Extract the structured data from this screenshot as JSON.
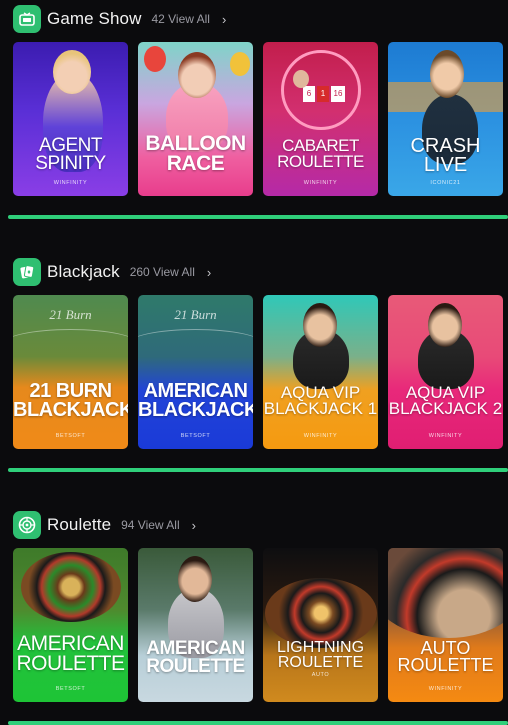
{
  "sections": [
    {
      "id": "game-show",
      "title": "Game Show",
      "count": "42 View All",
      "icon": "tv-icon",
      "games": [
        {
          "title": "AGENT\nSPINITY",
          "provider": "WINFINITY"
        },
        {
          "title": "BALLOON\nRACE",
          "provider": ""
        },
        {
          "title": "CABARET\nROULETTE",
          "provider": "WINFINITY"
        },
        {
          "title": "CRASH\nLIVE",
          "provider": "ICONIC21"
        }
      ]
    },
    {
      "id": "blackjack",
      "title": "Blackjack",
      "count": "260 View All",
      "icon": "cards-icon",
      "games": [
        {
          "title": "21 BURN\nBLACKJACK",
          "provider": "BETSOFT"
        },
        {
          "title": "AMERICAN\nBLACKJACK",
          "provider": "BETSOFT"
        },
        {
          "title": "AQUA VIP\nBLACKJACK 1",
          "provider": "WINFINITY"
        },
        {
          "title": "AQUA VIP\nBLACKJACK 2",
          "provider": "WINFINITY"
        }
      ]
    },
    {
      "id": "roulette",
      "title": "Roulette",
      "count": "94 View All",
      "icon": "roulette-icon",
      "games": [
        {
          "title": "AMERICAN\nROULETTE",
          "provider": "BETSOFT"
        },
        {
          "title": "AMERICAN\nROULETTE",
          "provider": ""
        },
        {
          "title": "LIGHTNING\nROULETTE",
          "provider": "AUTO"
        },
        {
          "title": "AUTO\nROULETTE",
          "provider": "WINFINITY"
        }
      ]
    }
  ],
  "chevron": "›",
  "colors": {
    "accent": "#2fcf7a",
    "background": "#0b0b0d"
  }
}
